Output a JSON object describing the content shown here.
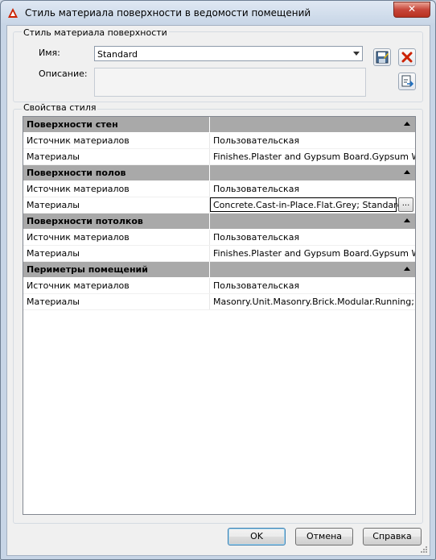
{
  "window": {
    "title": "Стиль материала поверхности в ведомости помещений",
    "close_glyph": "✕"
  },
  "surface_group": {
    "label": "Стиль материала поверхности",
    "name_label": "Имя:",
    "name_value": "Standard",
    "description_label": "Описание:",
    "description_value": ""
  },
  "icons": {
    "save": "save-style-icon",
    "delete": "delete-style-icon",
    "import": "import-style-icon"
  },
  "properties": {
    "label": "Свойства стиля",
    "rows": [
      {
        "type": "section",
        "label": "Поверхности стен"
      },
      {
        "type": "row",
        "label": "Источник материалов",
        "value": "Пользовательская"
      },
      {
        "type": "row",
        "label": "Материалы",
        "value": "Finishes.Plaster and Gypsum Board.Gypsum Wa"
      },
      {
        "type": "section",
        "label": "Поверхности полов"
      },
      {
        "type": "row",
        "label": "Источник материалов",
        "value": "Пользовательская"
      },
      {
        "type": "edit",
        "label": "Материалы",
        "value": "Concrete.Cast-in-Place.Flat.Grey; Standard"
      },
      {
        "type": "section",
        "label": "Поверхности потолков"
      },
      {
        "type": "row",
        "label": "Источник материалов",
        "value": "Пользовательская"
      },
      {
        "type": "row",
        "label": "Материалы",
        "value": "Finishes.Plaster and Gypsum Board.Gypsum Wa"
      },
      {
        "type": "section",
        "label": "Периметры помещений"
      },
      {
        "type": "row",
        "label": "Источник материалов",
        "value": "Пользовательская"
      },
      {
        "type": "row",
        "label": "Материалы",
        "value": "Masonry.Unit.Masonry.Brick.Modular.Running;"
      }
    ],
    "ellipsis": "..."
  },
  "buttons": {
    "ok": "OK",
    "cancel": "Отмена",
    "help": "Справка"
  },
  "colors": {
    "section_bg": "#a9a9a9",
    "accent_red": "#cc2200"
  }
}
